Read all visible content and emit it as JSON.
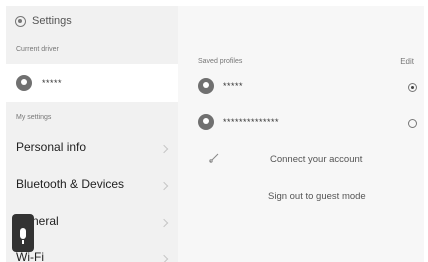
{
  "window": {
    "title": "Settings"
  },
  "sidebar": {
    "current_driver_label": "Current driver",
    "current_driver_name": "*****",
    "my_settings_label": "My settings",
    "items": [
      {
        "label": "Personal info"
      },
      {
        "label": "Bluetooth & Devices"
      },
      {
        "label": "General"
      },
      {
        "label": "Wi-Fi"
      }
    ]
  },
  "profiles": {
    "section_label": "Saved profiles",
    "edit_label": "Edit",
    "list": [
      {
        "name": "*****",
        "selected": true
      },
      {
        "name": "**************",
        "selected": false
      }
    ],
    "connect_label": "Connect your account",
    "guest_label": "Sign out to guest mode"
  },
  "icons": {
    "settings": "gear-icon",
    "avatar": "person-icon",
    "mic": "microphone-icon",
    "connect": "link-icon",
    "chevron": "chevron-right-icon"
  },
  "colors": {
    "sidebar_bg": "#f1f1f1",
    "selected_row_bg": "#ffffff",
    "content_bg": "#f7f7f7",
    "avatar_bg": "#707070"
  }
}
